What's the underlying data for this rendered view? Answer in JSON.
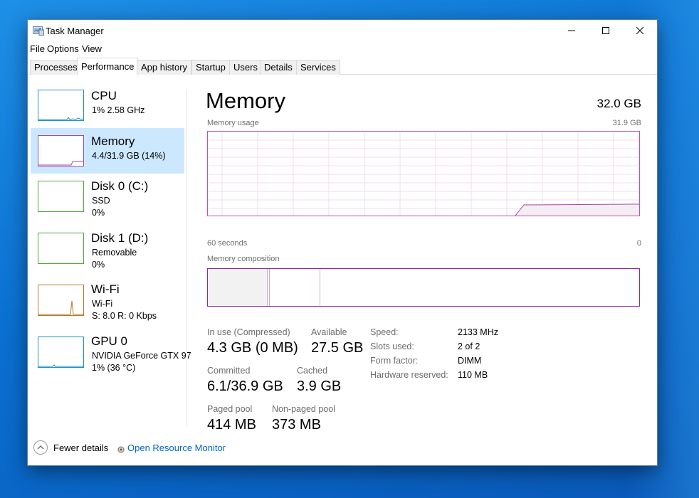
{
  "window": {
    "title": "Task Manager",
    "icon": "task-manager-icon"
  },
  "menu": [
    "File",
    "Options",
    "View"
  ],
  "tabs": [
    "Processes",
    "Performance",
    "App history",
    "Startup",
    "Users",
    "Details",
    "Services"
  ],
  "active_tab": "Performance",
  "sidebar": {
    "items": [
      {
        "title": "CPU",
        "line1": "1%  2.58 GHz",
        "line2": "",
        "color": "#1a93c8"
      },
      {
        "title": "Memory",
        "line1": "4.4/31.9 GB (14%)",
        "line2": "",
        "color": "#a64aa5"
      },
      {
        "title": "Disk 0 (C:)",
        "line1": "SSD",
        "line2": "0%",
        "color": "#52a83a"
      },
      {
        "title": "Disk 1 (D:)",
        "line1": "Removable",
        "line2": "0%",
        "color": "#52a83a"
      },
      {
        "title": "Wi-Fi",
        "line1": "Wi-Fi",
        "line2": "S: 8.0  R: 0 Kbps",
        "color": "#b3782a"
      },
      {
        "title": "GPU 0",
        "line1": "NVIDIA GeForce GTX 97",
        "line2": "1%  (36 °C)",
        "color": "#1a93c8"
      }
    ],
    "selected": "Memory"
  },
  "main": {
    "title": "Memory",
    "total": "32.0 GB",
    "usage_label": "Memory usage",
    "usage_max": "31.9 GB",
    "axis_left": "60 seconds",
    "axis_right": "0",
    "composition_label": "Memory composition",
    "stats": {
      "in_use_label": "In use (Compressed)",
      "in_use_value": "4.3 GB (0 MB)",
      "available_label": "Available",
      "available_value": "27.5 GB",
      "committed_label": "Committed",
      "committed_value": "6.1/36.9 GB",
      "cached_label": "Cached",
      "cached_value": "3.9 GB",
      "paged_label": "Paged pool",
      "paged_value": "414 MB",
      "nonpaged_label": "Non-paged pool",
      "nonpaged_value": "373 MB"
    },
    "specs": [
      {
        "label": "Speed:",
        "value": "2133 MHz"
      },
      {
        "label": "Slots used:",
        "value": "2 of 2"
      },
      {
        "label": "Form factor:",
        "value": "DIMM"
      },
      {
        "label": "Hardware reserved:",
        "value": "110 MB"
      }
    ]
  },
  "footer": {
    "fewer_details": "Fewer details",
    "open_resource_monitor": "Open Resource Monitor"
  },
  "colors": {
    "memory_accent": "#a64aa5",
    "selected_bg": "#cce8ff",
    "link": "#0066cc"
  }
}
